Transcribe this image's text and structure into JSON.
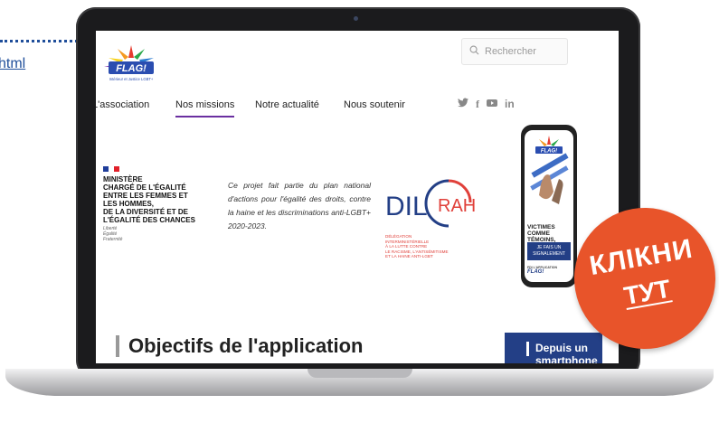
{
  "background": {
    "link_text": "html"
  },
  "site": {
    "logo_text": "FLAG!",
    "logo_subtitle": "Intérieur et Justice LGBT+",
    "search_placeholder": "Rechercher",
    "nav": [
      {
        "label": "L'association"
      },
      {
        "label": "Nos missions"
      },
      {
        "label": "Notre actualité"
      },
      {
        "label": "Nous soutenir"
      }
    ],
    "active_nav": "Nos missions",
    "social": [
      "twitter-icon",
      "facebook-icon",
      "youtube-icon",
      "linkedin-icon"
    ]
  },
  "banner": {
    "ministry_lines": [
      "MINISTÈRE",
      "CHARGÉ DE L'ÉGALITÉ",
      "ENTRE LES FEMMES ET",
      "LES HOMMES,",
      "DE LA DIVERSITÉ ET DE",
      "L'ÉGALITÉ DES CHANCES"
    ],
    "motto": [
      "Liberté",
      "Égalité",
      "Fraternité"
    ],
    "projet_text": "Ce projet fait partie du plan national d'actions pour l'égalité des droits, contre la haine et les discriminations anti-LGBT+ 2020-2023.",
    "dilcrah": {
      "left": "DIL",
      "right": "RAH",
      "lines": [
        "DÉLÉGATION",
        "INTERMINISTÉRIELLE",
        "À LA LUTTE CONTRE",
        "LE RACISME, L'ANTISÉMITISME",
        "ET LA HAINE ANTI-LGBT"
      ]
    }
  },
  "phone": {
    "victims_line1": "VICTIMES",
    "victims_line2": "COMME TÉMOINS,",
    "button_line1": "JE FAIS UN",
    "button_line2": "SIGNALEMENT",
    "footer_small": "FDI L'APPLICATION",
    "footer": "FLAG!"
  },
  "main": {
    "heading": "Objectifs de l'application",
    "side_box": "Depuis un smartphone"
  },
  "badge": {
    "line1": "КЛІКНИ",
    "line2": "ТУТ",
    "color": "#e8542a"
  },
  "colors": {
    "accent_blue": "#233f86",
    "nav_underline": "#6a2fa0",
    "dilcrah_red": "#e0403a",
    "dilcrah_blue": "#233f86"
  }
}
